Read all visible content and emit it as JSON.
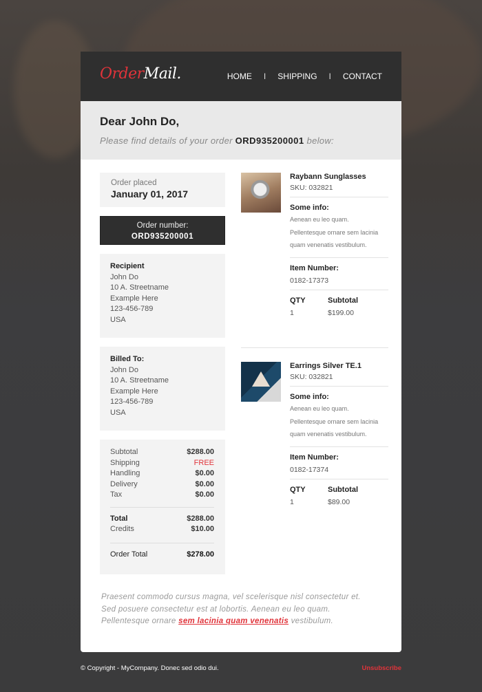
{
  "header": {
    "logo_part1": "Order",
    "logo_part2": "Mail.",
    "nav": [
      "HOME",
      "SHIPPING",
      "CONTACT"
    ],
    "separator": "I"
  },
  "greeting": {
    "title": "Dear John Do,",
    "text_before": "Please find details of your order",
    "order_id": "ORD935200001",
    "text_after": "below:"
  },
  "order": {
    "placed_label": "Order placed",
    "placed_date": "January 01, 2017",
    "number_label": "Order number:",
    "number": "ORD935200001"
  },
  "recipient": {
    "label": "Recipient",
    "lines": [
      "John Do",
      "10 A. Streetname",
      "Example Here",
      "123-456-789",
      "USA"
    ]
  },
  "billed": {
    "label": "Billed To:",
    "lines": [
      "John Do",
      "10 A. Streetname",
      "Example Here",
      "123-456-789",
      "USA"
    ]
  },
  "totals": {
    "rows": [
      {
        "label": "Subtotal",
        "value": "$288.00"
      },
      {
        "label": "Shipping",
        "value": "FREE"
      },
      {
        "label": "Handling",
        "value": "$0.00"
      },
      {
        "label": "Delivery",
        "value": "$0.00"
      },
      {
        "label": "Tax",
        "value": "$0.00"
      }
    ],
    "total_label": "Total",
    "total": "$288.00",
    "credits_label": "Credits",
    "credits": "$10.00",
    "order_total_label": "Order Total",
    "order_total": "$278.00"
  },
  "items": [
    {
      "name": "Raybann Sunglasses",
      "sku": "SKU: 032821",
      "info_label": "Some info:",
      "info": [
        "Aenean eu leo quam.",
        "Pellentesque ornare sem lacinia",
        "quam venenatis vestibulum."
      ],
      "item_number_label": "Item Number:",
      "item_number": "0182-17373",
      "qty_label": "QTY",
      "subtotal_label": "Subtotal",
      "qty": "1",
      "subtotal": "$199.00"
    },
    {
      "name": "Earrings Silver TE.1",
      "sku": "SKU: 032821",
      "info_label": "Some info:",
      "info": [
        "Aenean eu leo quam.",
        "Pellentesque ornare sem lacinia",
        "quam venenatis vestibulum."
      ],
      "item_number_label": "Item Number:",
      "item_number": "0182-17374",
      "qty_label": "QTY",
      "subtotal_label": "Subtotal",
      "qty": "1",
      "subtotal": "$89.00"
    }
  ],
  "note": {
    "line1": "Praesent commodo cursus magna, vel scelerisque nisl consectetur et.",
    "line2": "Sed posuere consectetur est at lobortis. Aenean eu leo quam.",
    "line3_before": "Pellentesque ornare",
    "link": "sem lacinia quam venenatis",
    "line3_after": "vestibulum."
  },
  "footer": {
    "copyright": "© Copyright - MyCompany. Donec sed odio dui.",
    "unsubscribe": "Unsubscribe"
  },
  "colors": {
    "accent": "#e0333a",
    "header_bg": "#2f2f2f",
    "greeting_bg": "#e9e9e9"
  }
}
